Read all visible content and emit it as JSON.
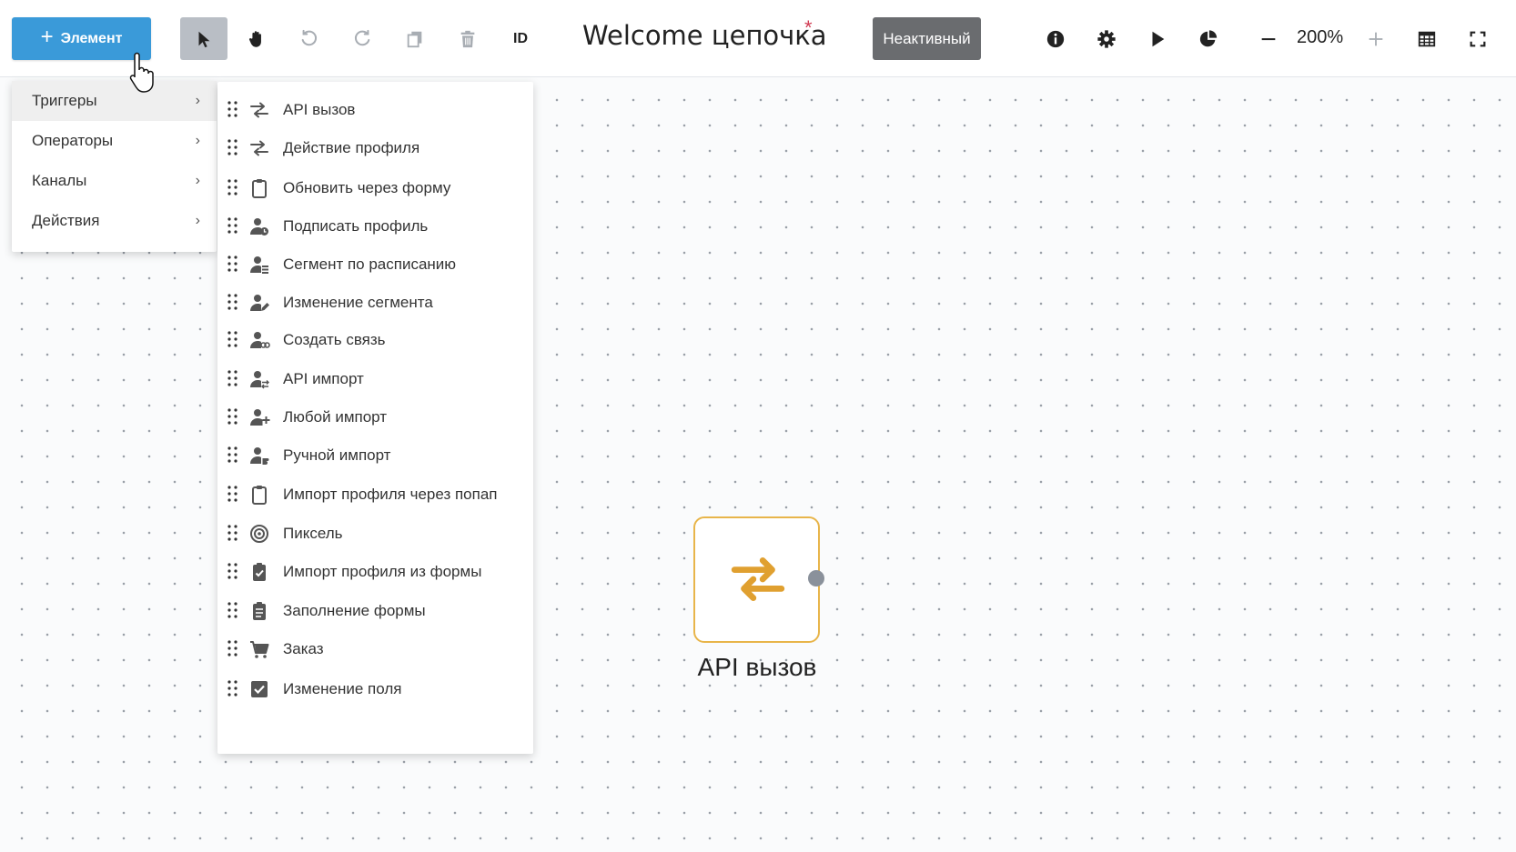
{
  "toolbar": {
    "add_label": "Элемент",
    "id_label": "ID",
    "chain_title": "Welcome цепочка",
    "required_mark": "*",
    "status_label": "Неактивный",
    "zoom_value": "200%"
  },
  "menu": {
    "categories": [
      {
        "label": "Триггеры",
        "chevron": "›"
      },
      {
        "label": "Операторы",
        "chevron": "›"
      },
      {
        "label": "Каналы",
        "chevron": "›"
      },
      {
        "label": "Действия",
        "chevron": "›"
      }
    ],
    "triggers": [
      {
        "label": "API вызов",
        "icon": "exchange-icon"
      },
      {
        "label": "Действие профиля",
        "icon": "exchange-icon"
      },
      {
        "label": "Обновить через форму",
        "icon": "clipboard-icon"
      },
      {
        "label": "Подписать профиль",
        "icon": "user-clock-icon"
      },
      {
        "label": "Сегмент по расписанию",
        "icon": "user-list-icon"
      },
      {
        "label": "Изменение сегмента",
        "icon": "user-edit-icon"
      },
      {
        "label": "Создать связь",
        "icon": "user-link-icon"
      },
      {
        "label": "API импорт",
        "icon": "user-exchange-icon"
      },
      {
        "label": "Любой импорт",
        "icon": "user-plus-icon"
      },
      {
        "label": "Ручной импорт",
        "icon": "user-hand-icon"
      },
      {
        "label": "Импорт профиля через попап",
        "icon": "clipboard-icon"
      },
      {
        "label": "Пиксель",
        "icon": "target-icon"
      },
      {
        "label": "Импорт профиля из формы",
        "icon": "clipboard-check-icon"
      },
      {
        "label": "Заполнение формы",
        "icon": "clipboard-list-icon"
      },
      {
        "label": "Заказ",
        "icon": "cart-icon"
      },
      {
        "label": "Изменение поля",
        "icon": "checkbox-icon"
      }
    ]
  },
  "node": {
    "label": "API вызов",
    "icon": "exchange-icon",
    "accent_color": "#e0a030"
  },
  "colors": {
    "primary": "#3a9ad9",
    "inactive": "#6a6c6f",
    "node_border": "#e8b54a"
  }
}
